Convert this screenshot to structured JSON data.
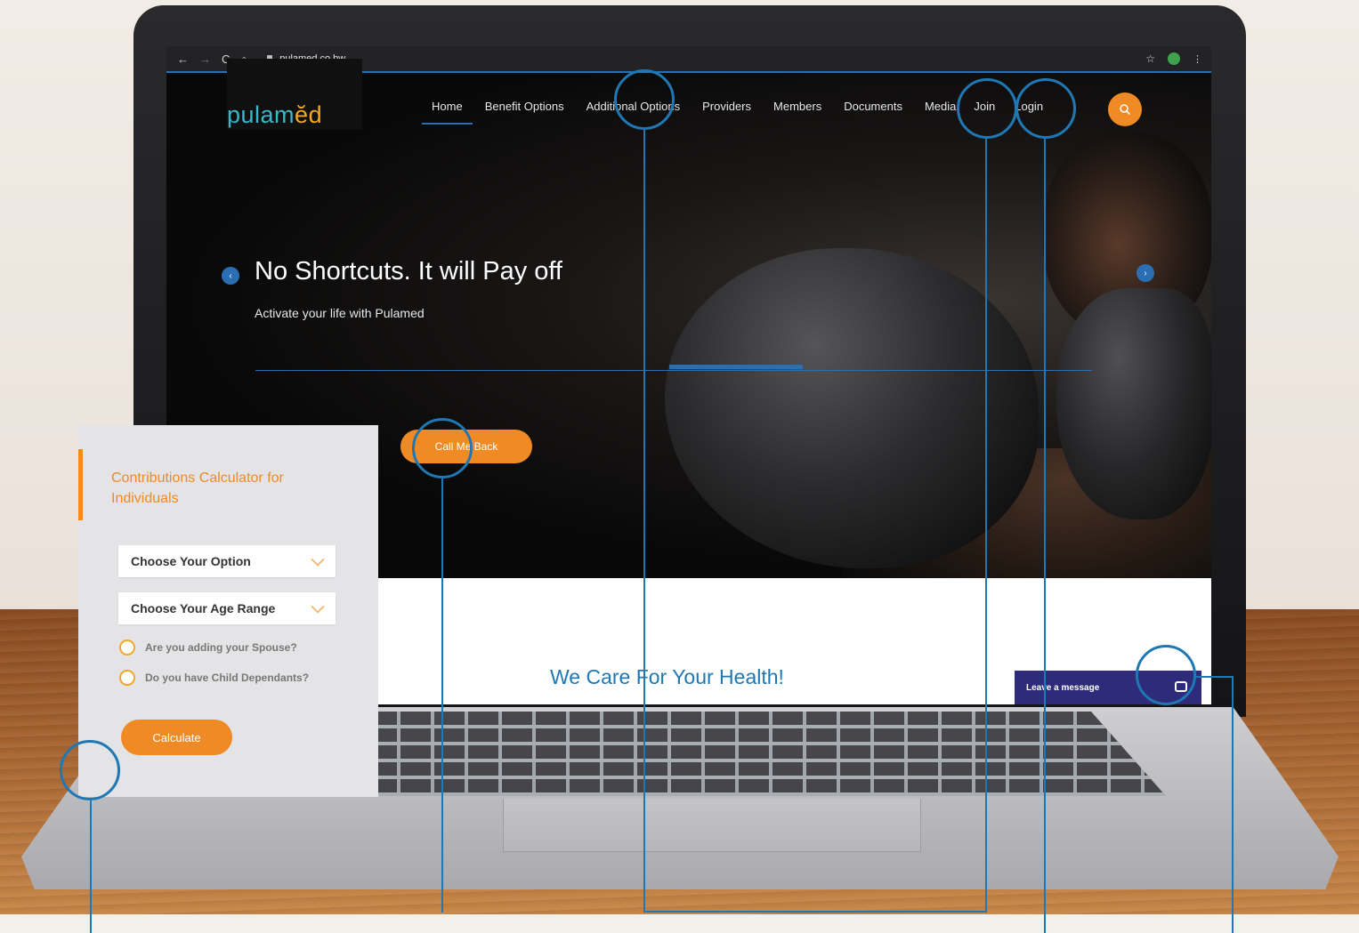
{
  "browser": {
    "url": "pulamed.co.bw"
  },
  "site": {
    "logo_main": "pulam",
    "logo_accent": "ĕd",
    "nav": [
      {
        "label": "Home"
      },
      {
        "label": "Benefit Options"
      },
      {
        "label": "Additional Options"
      },
      {
        "label": "Providers"
      },
      {
        "label": "Members"
      },
      {
        "label": "Documents"
      },
      {
        "label": "Media"
      },
      {
        "label": "Join"
      },
      {
        "label": "Login"
      }
    ],
    "search_icon": "search-icon"
  },
  "hero": {
    "title": "No Shortcuts. It will Pay off",
    "subtitle": "Activate your life with Pulamed",
    "button": "Call Me Back",
    "slide_progress": 0.16
  },
  "section": {
    "title": "We Care For Your Health!"
  },
  "chat": {
    "label": "Leave a message"
  },
  "calculator": {
    "title": "Contributions Calculator for Individuals",
    "select_option": "Choose Your Option",
    "select_age": "Choose Your Age Range",
    "check_spouse": "Are you adding your Spouse?",
    "check_children": "Do you have Child Dependants?",
    "button": "Calculate"
  },
  "colors": {
    "accent_orange": "#f08a24",
    "brand_blue": "#1f78b4",
    "chat_navy": "#2d2b7a"
  }
}
